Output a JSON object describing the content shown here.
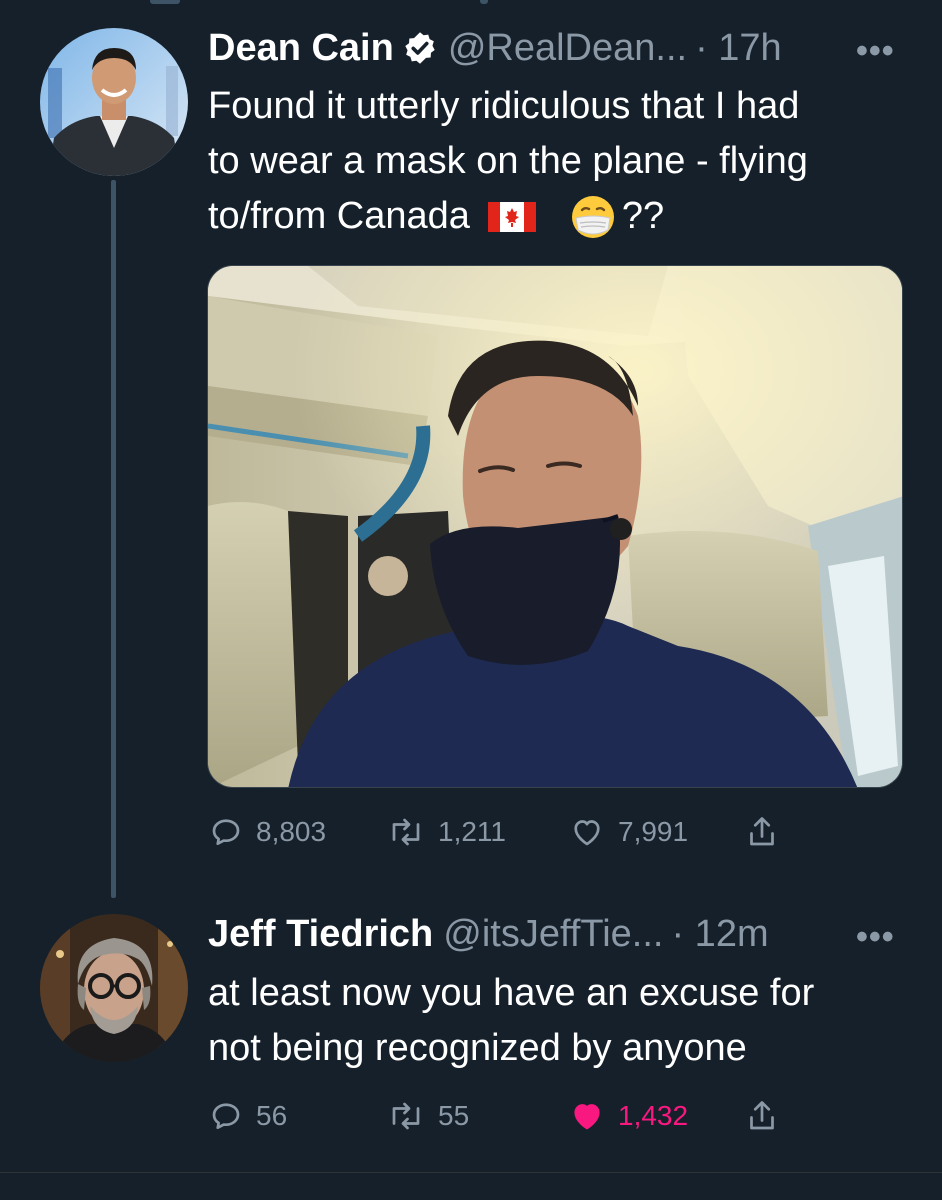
{
  "tweets": [
    {
      "name": "Dean Cain",
      "verified": true,
      "handle": "@RealDean...",
      "time": "· 17h",
      "more": "•••",
      "text_lines": [
        "Found it utterly ridiculous that I had",
        "to wear a mask on the plane - flying",
        "to/from Canada",
        "??"
      ],
      "emoji_flag": "canada-flag-icon",
      "emoji_mask": "face-with-medical-mask-icon",
      "stats": {
        "replies": "8,803",
        "retweets": "1,211",
        "likes": "7,991"
      }
    },
    {
      "name": "Jeff Tiedrich",
      "verified": false,
      "handle": "@itsJeffTie...",
      "time": "· 12m",
      "more": "•••",
      "text_lines": [
        "at least now you have an excuse for",
        "not being recognized by anyone"
      ],
      "stats": {
        "replies": "56",
        "retweets": "55",
        "likes": "1,432",
        "liked": true
      }
    }
  ],
  "colors": {
    "background": "#15202b",
    "secondary_text": "#8b98a5",
    "verified_blue": "#1d9bf0",
    "like_pink": "#f91880",
    "thread_line": "#3d5466"
  }
}
